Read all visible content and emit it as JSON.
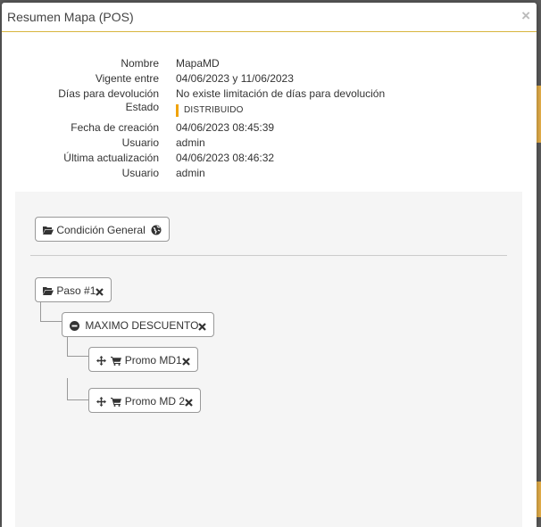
{
  "modal": {
    "title": "Resumen Mapa (POS)",
    "close_symbol": "×"
  },
  "summary": [
    {
      "label": "Nombre",
      "value": "MapaMD"
    },
    {
      "label": "Vigente entre",
      "value": "04/06/2023 y 11/06/2023"
    },
    {
      "label": "Días para devolución",
      "value": "No existe limitación de días para devolución"
    },
    {
      "label": "Estado",
      "value": "DISTRIBUIDO"
    },
    {
      "label": "Fecha de creación",
      "value": "04/06/2023 08:45:39"
    },
    {
      "label": "Usuario",
      "value": "admin"
    },
    {
      "label": "Última actualización",
      "value": "04/06/2023 08:46:32"
    },
    {
      "label": "Usuario",
      "value": "admin"
    }
  ],
  "tree": {
    "general": {
      "label": "Condición General",
      "icon": "folder-open-icon",
      "trailing_icon": "globe-icon"
    },
    "step": {
      "label": "Paso #1",
      "icon": "folder-open-icon"
    },
    "group": {
      "label": "MAXIMO DESCUENTO",
      "icon": "minus-circle-icon"
    },
    "promos": [
      {
        "label": "Promo MD1",
        "icons": [
          "move-icon",
          "cart-icon"
        ]
      },
      {
        "label": "Promo MD 2",
        "icons": [
          "move-icon",
          "cart-icon"
        ]
      }
    ]
  },
  "colors": {
    "header_accent": "#d8b53e",
    "status_accent": "#f0a30a"
  }
}
